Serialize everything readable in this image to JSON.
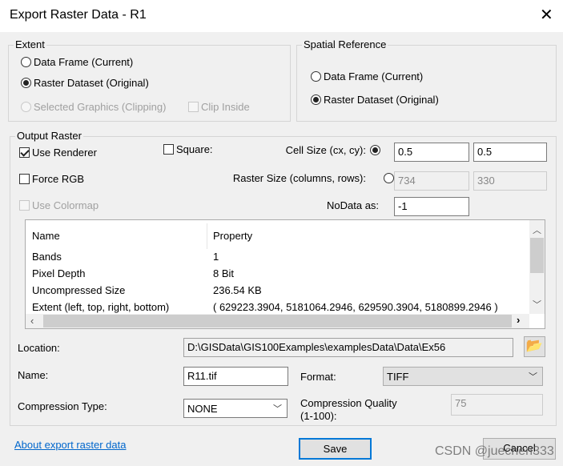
{
  "window": {
    "title": "Export Raster Data - R1",
    "close_icon": "close-icon"
  },
  "extent": {
    "label": "Extent",
    "data_frame": "Data Frame (Current)",
    "raster_dataset": "Raster Dataset (Original)",
    "selected_graphics": "Selected Graphics (Clipping)",
    "clip_inside": "Clip Inside",
    "selected": "raster_dataset"
  },
  "spatial_reference": {
    "label": "Spatial Reference",
    "data_frame": "Data Frame (Current)",
    "raster_dataset": "Raster Dataset (Original)",
    "selected": "raster_dataset"
  },
  "output_raster": {
    "label": "Output Raster",
    "use_renderer": "Use Renderer",
    "use_renderer_checked": true,
    "square": "Square:",
    "force_rgb": "Force RGB",
    "use_colormap": "Use Colormap",
    "cell_size_label": "Cell Size (cx, cy):",
    "cell_cx": "0.5",
    "cell_cy": "0.5",
    "raster_size_label": "Raster Size (columns, rows):",
    "columns": "734",
    "rows": "330",
    "nodata_label": "NoData as:",
    "nodata": "-1"
  },
  "properties": {
    "headers": [
      "Name",
      "Property"
    ],
    "rows": [
      [
        "Bands",
        "1"
      ],
      [
        "Pixel Depth",
        "8 Bit"
      ],
      [
        "Uncompressed Size",
        "236.54 KB"
      ],
      [
        "Extent (left, top, right, bottom)",
        "( 629223.3904, 5181064.2946, 629590.3904, 5180899.2946 )"
      ]
    ]
  },
  "location": {
    "label": "Location:",
    "value": "D:\\GISData\\GIS100Examples\\examplesData\\Data\\Ex56"
  },
  "name": {
    "label": "Name:",
    "value": "R11.tif"
  },
  "format": {
    "label": "Format:",
    "value": "TIFF"
  },
  "compression_type": {
    "label": "Compression Type:",
    "value": "NONE"
  },
  "compression_quality": {
    "label1": "Compression Quality",
    "label2": "(1-100):",
    "value": "75"
  },
  "footer": {
    "about_link": "About export raster data",
    "save": "Save",
    "cancel": "Cancel"
  },
  "watermark": "CSDN @juechen333",
  "colors": {
    "link": "#0066cc",
    "save_border": "#0078d7"
  }
}
